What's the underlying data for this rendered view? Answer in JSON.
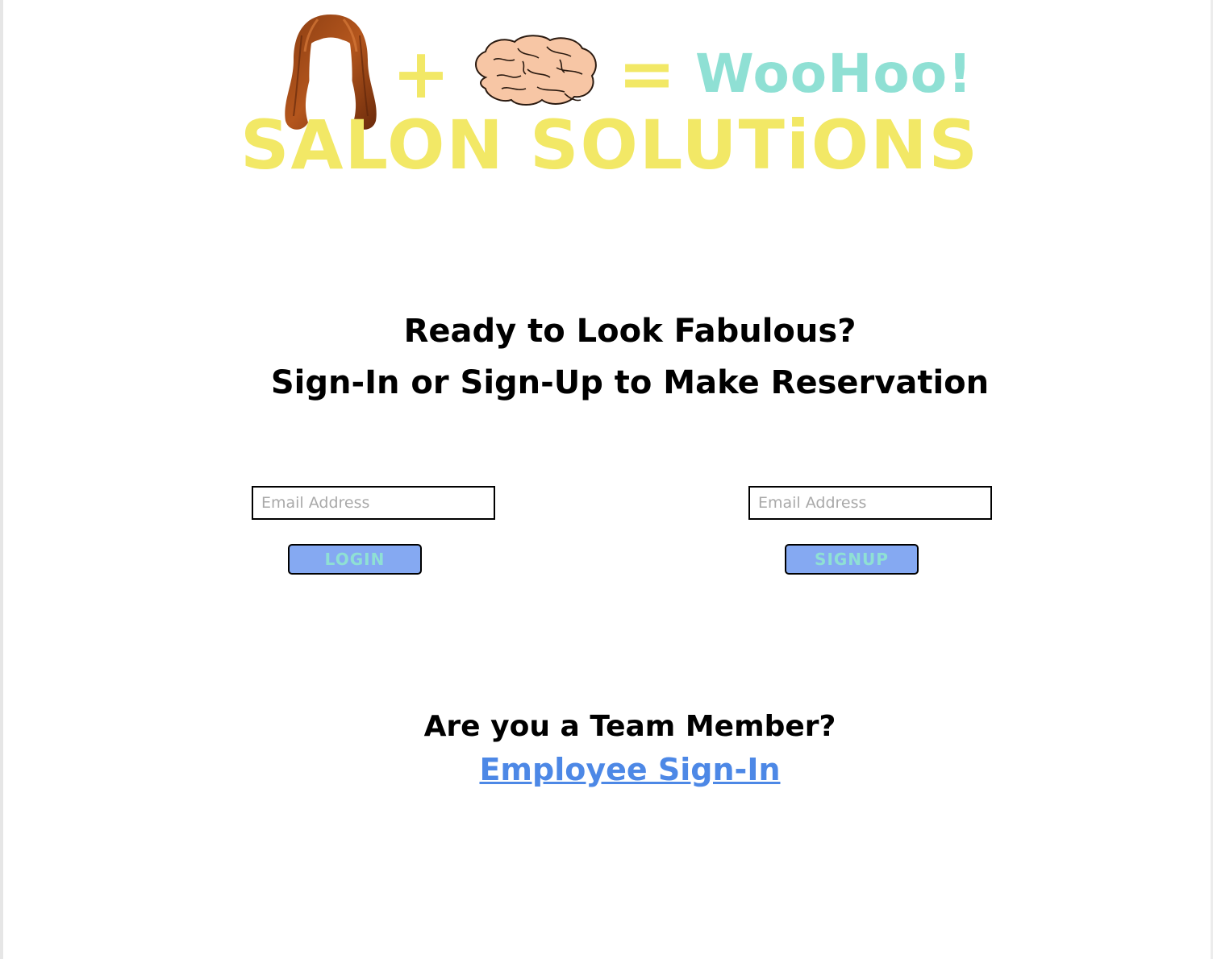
{
  "header": {
    "plus": "+",
    "equals": "=",
    "tagline": "WooHoo!",
    "brand": "SALON SOLUTiONS",
    "hair_image": "wig-hair-icon",
    "brain_image": "brain-icon"
  },
  "main": {
    "headline_line1": "Ready to Look Fabulous?",
    "headline_line2": "Sign-In or Sign-Up to Make Reservation"
  },
  "login": {
    "email_placeholder": "Email Address",
    "email_value": "",
    "button_label": "LOGIN"
  },
  "signup": {
    "email_placeholder": "Email Address",
    "email_value": "",
    "button_label": "SIGNUP"
  },
  "team": {
    "question": "Are you a Team Member?",
    "link_label": "Employee Sign-In"
  },
  "colors": {
    "brand_yellow": "#f2e866",
    "tagline_teal": "#8fe0d4",
    "button_blue": "#85a9f2",
    "link_blue": "#4d88e6"
  }
}
